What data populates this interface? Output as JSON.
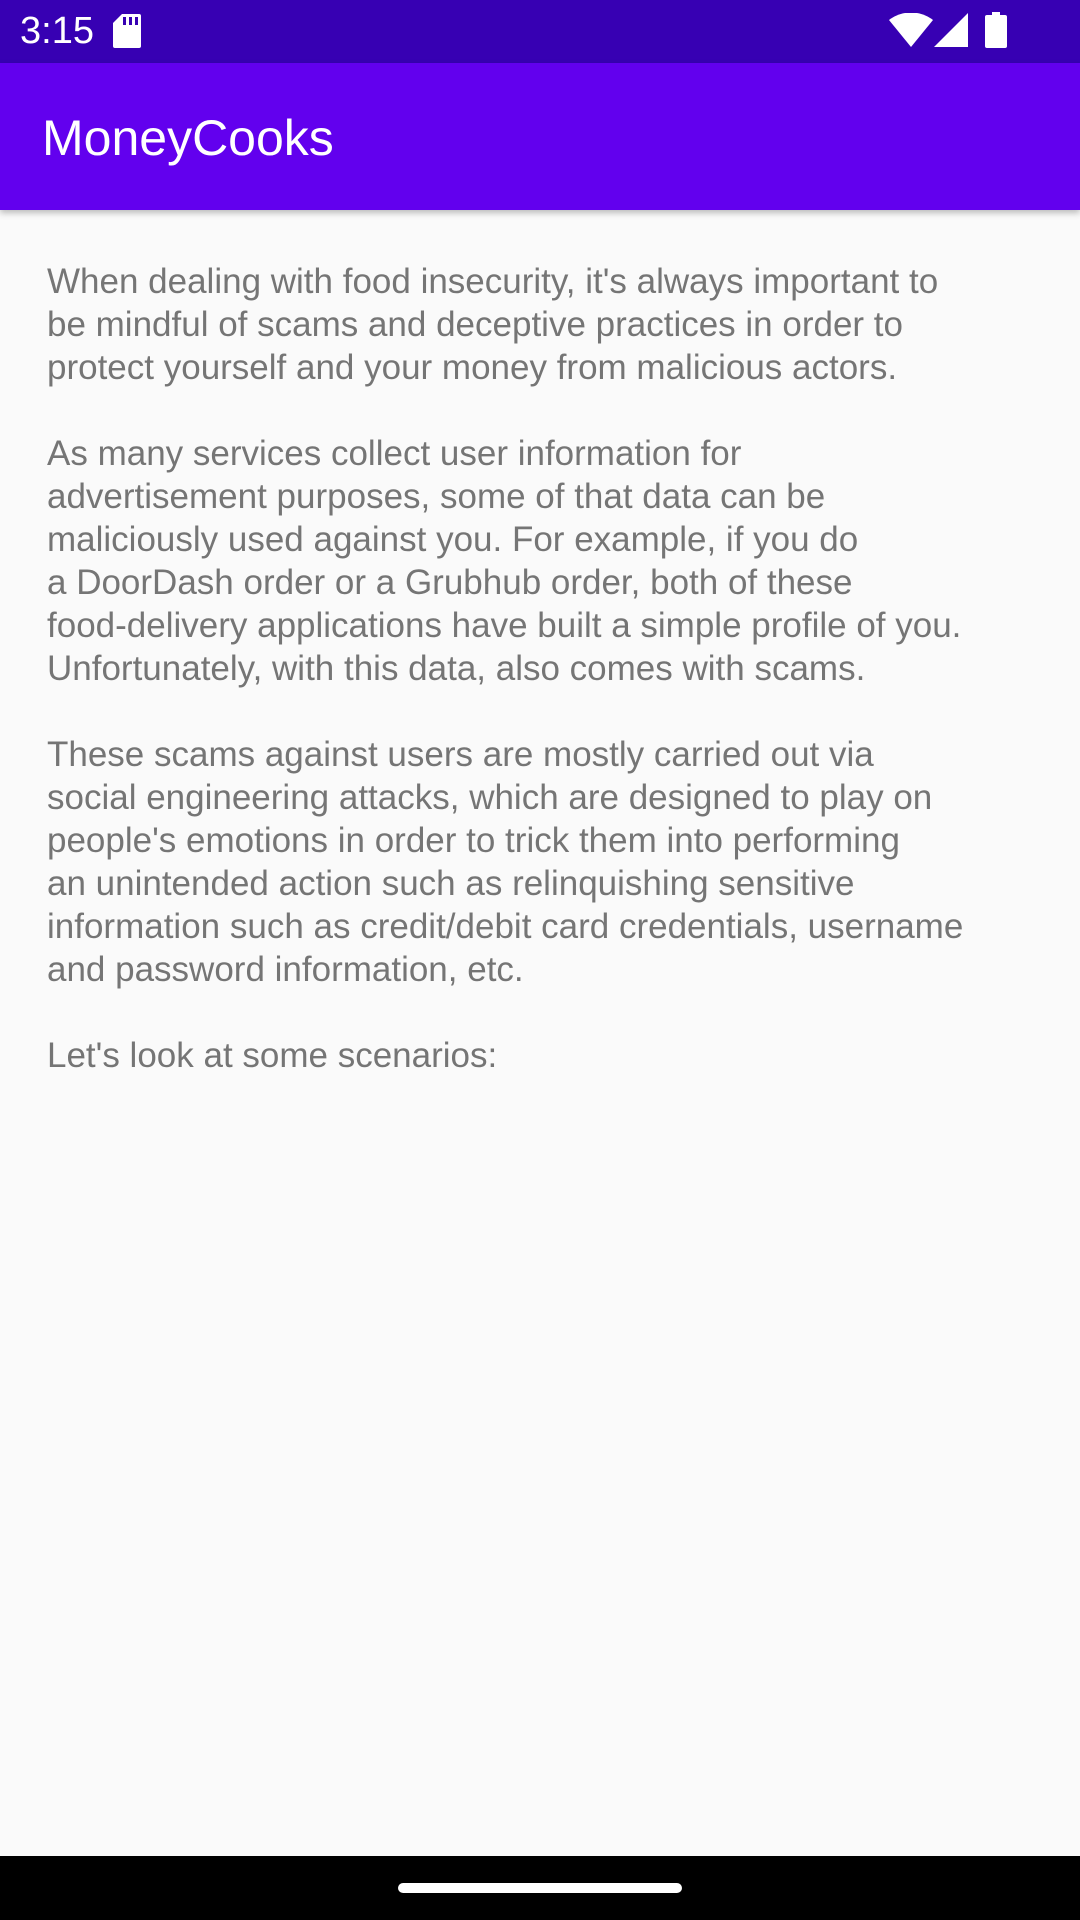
{
  "status_bar": {
    "time": "3:15",
    "icons": [
      "sd-card-icon",
      "wifi-icon",
      "cell-signal-icon",
      "battery-icon"
    ]
  },
  "app_bar": {
    "title": "MoneyCooks"
  },
  "content": {
    "paragraphs": [
      "When dealing with food insecurity, it's always important to\nbe mindful of scams and deceptive practices in order to\nprotect yourself and your money from malicious actors.",
      "As many services collect user information for\nadvertisement purposes, some of that data can be\nmaliciously used against you. For example, if you do\na DoorDash order or a Grubhub order, both of these\nfood-delivery applications have built a simple profile of you.\nUnfortunately, with this data, also comes with scams.",
      "These scams against users are mostly carried out via\nsocial engineering attacks, which are designed to play on\npeople's emotions in order to trick them into performing\nan unintended action such as relinquishing sensitive\ninformation such as credit/debit card credentials, username\nand password information, etc.",
      "Let's look at some scenarios:"
    ]
  },
  "colors": {
    "status_bar": "#3700b3",
    "app_bar": "#6200ee",
    "body_text": "#757575",
    "background": "#fafafa"
  }
}
